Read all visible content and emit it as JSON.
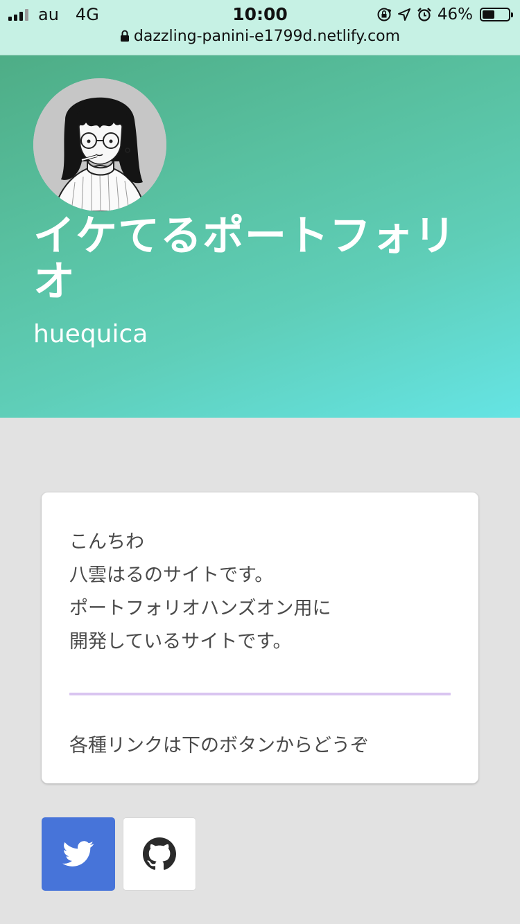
{
  "status_bar": {
    "carrier": "au",
    "network": "4G",
    "time": "10:00",
    "battery_percent": "46%",
    "battery_level": 0.46,
    "icons": [
      "signal-icon",
      "rotation-lock-icon",
      "location-icon",
      "alarm-icon",
      "battery-icon"
    ]
  },
  "browser": {
    "url": "dazzling-panini-e1799d.netlify.com"
  },
  "hero": {
    "title": "イケてるポートフォリオ",
    "subtitle": "huequica",
    "gradient": [
      "#4ead86",
      "#65e4e4"
    ]
  },
  "card": {
    "lines": [
      "こんちわ",
      "八雲はるのサイトです。",
      "ポートフォリオハンズオン用に",
      "開発しているサイトです。"
    ],
    "link_text": "各種リンクは下のボタンからどうぞ",
    "divider_color": "#d9c5f0"
  },
  "buttons": {
    "twitter": {
      "icon": "twitter-icon",
      "color": "#4774d9"
    },
    "github": {
      "icon": "github-icon",
      "color": "#ffffff"
    }
  }
}
